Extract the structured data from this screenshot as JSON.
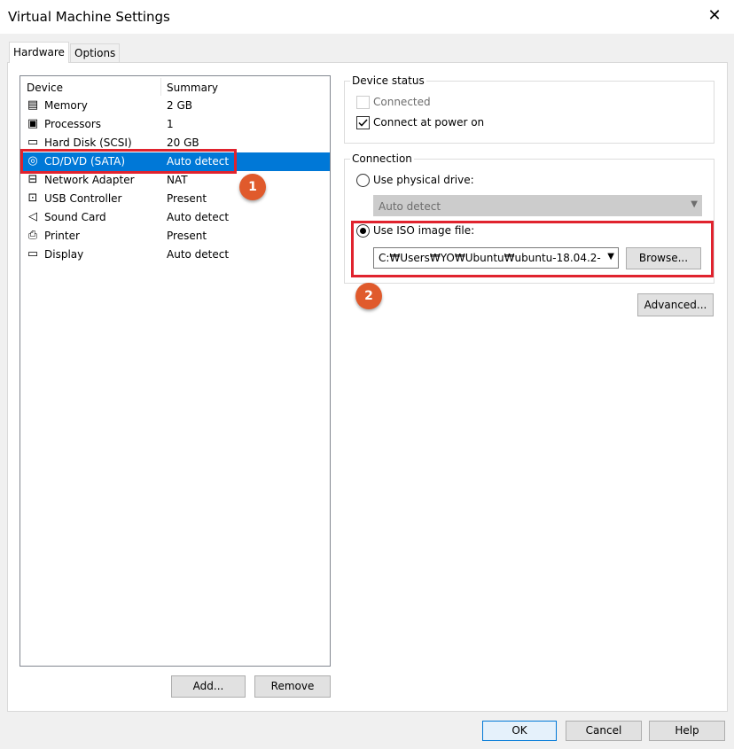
{
  "window": {
    "title": "Virtual Machine Settings"
  },
  "tabs": [
    {
      "label": "Hardware"
    },
    {
      "label": "Options"
    }
  ],
  "device_list": {
    "columns": {
      "device": "Device",
      "summary": "Summary"
    },
    "items": [
      {
        "name": "Memory",
        "summary": "2 GB",
        "icon": "memory-icon"
      },
      {
        "name": "Processors",
        "summary": "1",
        "icon": "processor-icon"
      },
      {
        "name": "Hard Disk (SCSI)",
        "summary": "20 GB",
        "icon": "hard-disk-icon"
      },
      {
        "name": "CD/DVD (SATA)",
        "summary": "Auto detect",
        "icon": "cd-dvd-icon"
      },
      {
        "name": "Network Adapter",
        "summary": "NAT",
        "icon": "network-adapter-icon"
      },
      {
        "name": "USB Controller",
        "summary": "Present",
        "icon": "usb-icon"
      },
      {
        "name": "Sound Card",
        "summary": "Auto detect",
        "icon": "speaker-icon"
      },
      {
        "name": "Printer",
        "summary": "Present",
        "icon": "printer-icon"
      },
      {
        "name": "Display",
        "summary": "Auto detect",
        "icon": "display-icon"
      }
    ],
    "selected_index": 3
  },
  "list_buttons": {
    "add": "Add...",
    "remove": "Remove"
  },
  "device_status": {
    "label": "Device status",
    "connected": "Connected",
    "connect_at_power_on": "Connect at power on"
  },
  "connection": {
    "label": "Connection",
    "use_physical": "Use physical drive:",
    "physical_value": "Auto detect",
    "use_iso": "Use ISO image file:",
    "iso_path": "C:₩Users₩YO₩Ubuntu₩ubuntu-18.04.2-",
    "browse": "Browse..."
  },
  "advanced": "Advanced...",
  "footer": {
    "ok": "OK",
    "cancel": "Cancel",
    "help": "Help"
  },
  "annotations": {
    "one": "1",
    "two": "2"
  },
  "colors": {
    "selection": "#0078d7",
    "highlight_box": "#e0232e",
    "badge": "#e05a2c"
  }
}
